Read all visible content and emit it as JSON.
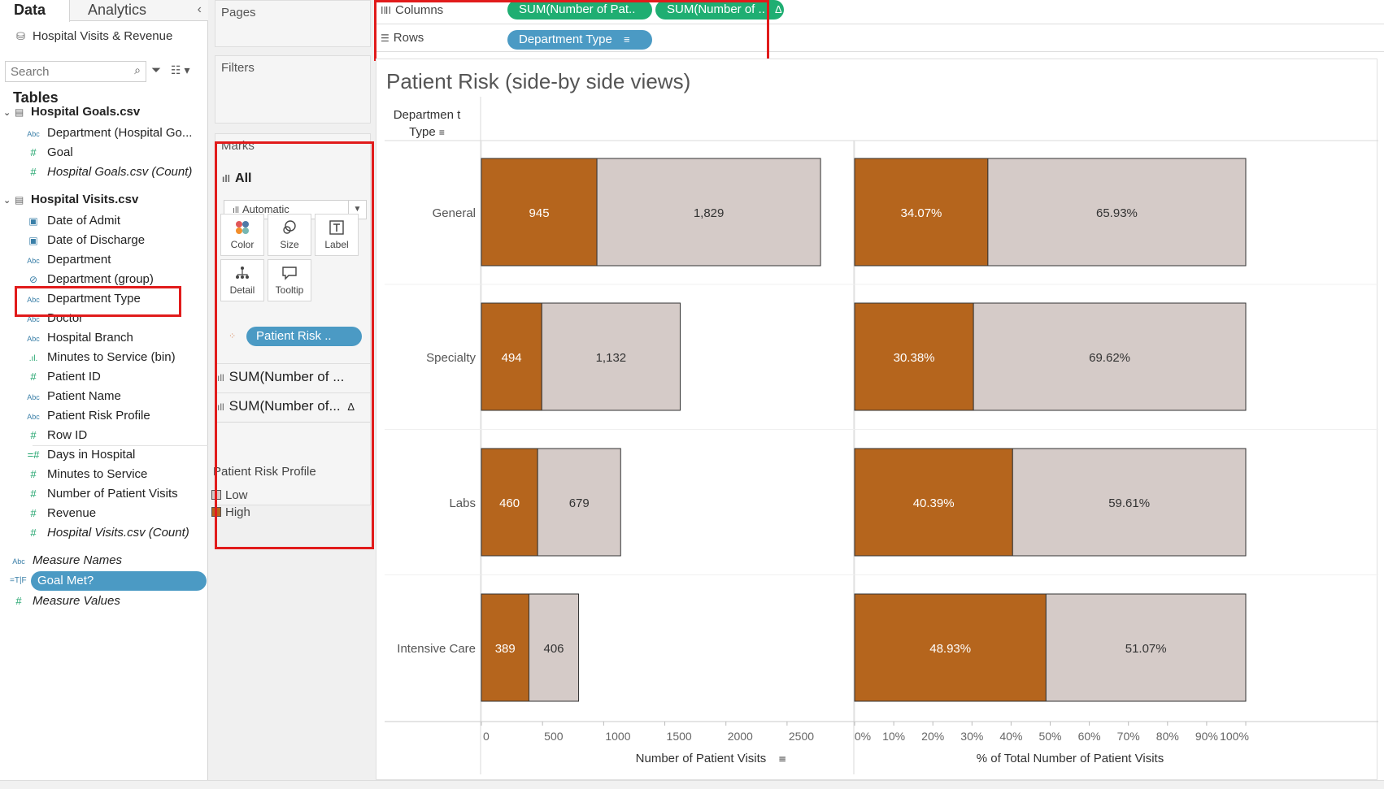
{
  "pane": {
    "tab_data": "Data",
    "tab_analytics": "Analytics",
    "collapse_glyph": "‹",
    "datasource": "Hospital Visits & Revenue",
    "search_placeholder": "Search",
    "tables_title": "Tables"
  },
  "tables": [
    {
      "name": "Hospital Goals.csv",
      "fields": [
        {
          "type": "Abc",
          "label": "Department (Hospital Go...",
          "kind": "dim"
        },
        {
          "type": "#",
          "label": "Goal",
          "kind": "measure"
        },
        {
          "type": "#",
          "label": "Hospital Goals.csv (Count)",
          "kind": "measure",
          "italic": true
        }
      ]
    },
    {
      "name": "Hospital Visits.csv",
      "fields": [
        {
          "type": "▣",
          "label": "Date of Admit",
          "kind": "date"
        },
        {
          "type": "▣",
          "label": "Date of Discharge",
          "kind": "date"
        },
        {
          "type": "Abc",
          "label": "Department",
          "kind": "dim"
        },
        {
          "type": "⊘",
          "label": "Department (group)",
          "kind": "group"
        },
        {
          "type": "Abc",
          "label": "Department Type",
          "kind": "dim"
        },
        {
          "type": "Abc",
          "label": "Doctor",
          "kind": "dim"
        },
        {
          "type": "Abc",
          "label": "Hospital Branch",
          "kind": "dim"
        },
        {
          "type": ".ıl.",
          "label": "Minutes to Service (bin)",
          "kind": "bin"
        },
        {
          "type": "#",
          "label": "Patient ID",
          "kind": "measure"
        },
        {
          "type": "Abc",
          "label": "Patient Name",
          "kind": "dim"
        },
        {
          "type": "Abc",
          "label": "Patient Risk Profile",
          "kind": "dim"
        },
        {
          "type": "#",
          "label": "Row ID",
          "kind": "measure"
        },
        {
          "type": "=#",
          "label": "Days in Hospital",
          "kind": "measure"
        },
        {
          "type": "#",
          "label": "Minutes to Service",
          "kind": "measure"
        },
        {
          "type": "#",
          "label": "Number of Patient Visits",
          "kind": "measure"
        },
        {
          "type": "#",
          "label": "Revenue",
          "kind": "measure"
        },
        {
          "type": "#",
          "label": "Hospital Visits.csv (Count)",
          "kind": "measure",
          "italic": true
        }
      ]
    }
  ],
  "extra_fields": [
    {
      "type": "Abc",
      "label": "Measure Names",
      "kind": "dim",
      "italic": true
    },
    {
      "type": "=T|F",
      "label": "Goal Met?",
      "kind": "bool",
      "selected": true
    },
    {
      "type": "#",
      "label": "Measure Values",
      "kind": "measure",
      "italic": true
    }
  ],
  "cards": {
    "pages_title": "Pages",
    "filters_title": "Filters",
    "marks_title": "Marks",
    "marks_all": "All",
    "mark_type": "Automatic",
    "buttons": [
      {
        "id": "color",
        "label": "Color",
        "icon": "color-icon"
      },
      {
        "id": "size",
        "label": "Size",
        "icon": "size-icon"
      },
      {
        "id": "label",
        "label": "Label",
        "icon": "label-icon"
      },
      {
        "id": "detail",
        "label": "Detail",
        "icon": "detail-icon"
      },
      {
        "id": "tooltip",
        "label": "Tooltip",
        "icon": "tooltip-icon"
      }
    ],
    "color_pill": "Patient Risk ..",
    "marks_sub1": "SUM(Number of ...",
    "marks_sub2": "SUM(Number of...",
    "marks_sub2_delta": "Δ",
    "legend_title": "Patient Risk Profile",
    "legend_items": [
      {
        "label": "Low",
        "color": "#d5cbc8"
      },
      {
        "label": "High",
        "color": "#b5651d"
      }
    ]
  },
  "shelves": {
    "columns_label": "Columns",
    "rows_label": "Rows",
    "column_pills": [
      "SUM(Number of Pat..",
      "SUM(Number of ..",
      "Δ"
    ],
    "row_pill": "Department Type",
    "row_pill_sort": "≡"
  },
  "viz": {
    "title": "Patient Risk (side-by side views)",
    "row_header": "Departmen t Type",
    "sort_glyph": "≡"
  },
  "chart_data": {
    "type": "bar",
    "orientation": "horizontal-stacked",
    "categories": [
      "General",
      "Specialty",
      "Labs",
      "Intensive Care"
    ],
    "colors": {
      "High": "#b5651d",
      "Low": "#d5cbc8"
    },
    "panels": [
      {
        "xlabel": "Number of Patient Visits",
        "xlim": [
          0,
          2800
        ],
        "ticks": [
          "0",
          "500",
          "1000",
          "1500",
          "2000",
          "2500"
        ],
        "tick_values": [
          0,
          500,
          1000,
          1500,
          2000,
          2500
        ],
        "series": [
          {
            "name": "High",
            "values": [
              945,
              494,
              460,
              389
            ],
            "labels": [
              "945",
              "494",
              "460",
              "389"
            ]
          },
          {
            "name": "Low",
            "values": [
              1829,
              1132,
              679,
              406
            ],
            "labels": [
              "1,829",
              "1,132",
              "679",
              "406"
            ]
          }
        ]
      },
      {
        "xlabel": "% of Total Number of Patient Visits",
        "xlim": [
          0,
          100
        ],
        "ticks": [
          "0%",
          "10%",
          "20%",
          "30%",
          "40%",
          "50%",
          "60%",
          "70%",
          "80%",
          "90%",
          "100%"
        ],
        "tick_values": [
          0,
          10,
          20,
          30,
          40,
          50,
          60,
          70,
          80,
          90,
          100
        ],
        "series": [
          {
            "name": "High",
            "values": [
              34.07,
              30.38,
              40.39,
              48.93
            ],
            "labels": [
              "34.07%",
              "30.38%",
              "40.39%",
              "48.93%"
            ]
          },
          {
            "name": "Low",
            "values": [
              65.93,
              69.62,
              59.61,
              51.07
            ],
            "labels": [
              "65.93%",
              "69.62%",
              "59.61%",
              "51.07%"
            ]
          }
        ]
      }
    ]
  }
}
